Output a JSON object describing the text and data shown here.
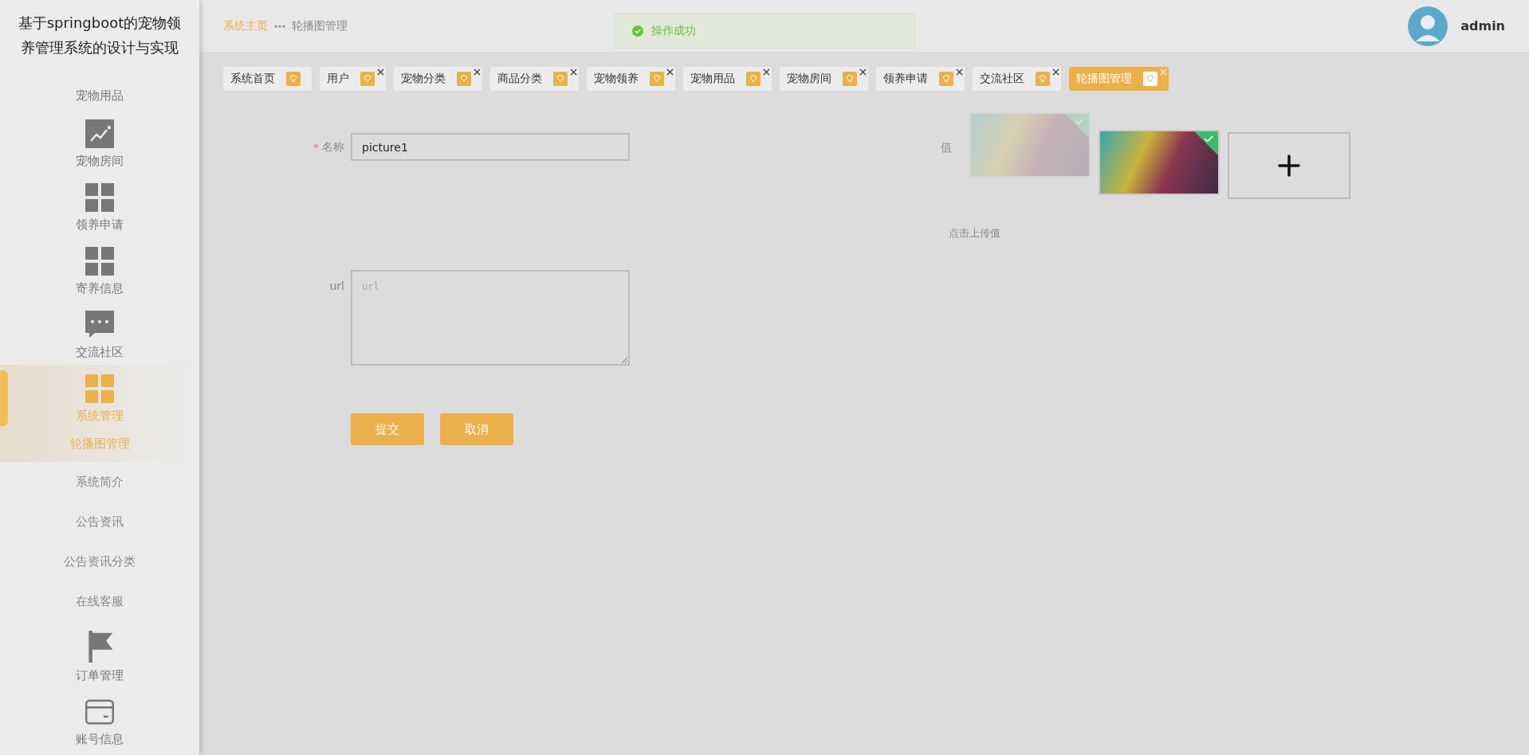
{
  "sidebar": {
    "title": "基于springboot的宠物领养管理系统的设计与实现",
    "items": [
      {
        "label": "宠物用品",
        "kind": "label",
        "expanded": false
      },
      {
        "label": "宠物房间",
        "kind": "chart",
        "expanded": false
      },
      {
        "label": "领养申请",
        "kind": "grid",
        "expanded": false
      },
      {
        "label": "寄养信息",
        "kind": "grid",
        "expanded": false
      },
      {
        "label": "交流社区",
        "kind": "chat",
        "expanded": false
      },
      {
        "label": "系统管理",
        "kind": "grid",
        "expanded": true,
        "children": [
          {
            "label": "轮播图管理",
            "selected": true
          },
          {
            "label": "系统简介",
            "selected": false
          },
          {
            "label": "公告资讯",
            "selected": false
          },
          {
            "label": "公告资讯分类",
            "selected": false
          },
          {
            "label": "在线客服",
            "selected": false
          }
        ]
      },
      {
        "label": "订单管理",
        "kind": "flag",
        "expanded": false
      },
      {
        "label": "账号信息",
        "kind": "card",
        "expanded": false
      }
    ]
  },
  "breadcrumb": [
    {
      "label": "系统主页",
      "current": false
    },
    {
      "label": "轮播图管理",
      "current": true
    }
  ],
  "toast": {
    "message": "操作成功",
    "kind": "success"
  },
  "user": {
    "name": "admin"
  },
  "tabs": [
    {
      "label": "系统首页",
      "closable": false,
      "selected": false
    },
    {
      "label": "用户",
      "closable": true,
      "selected": false
    },
    {
      "label": "宠物分类",
      "closable": true,
      "selected": false
    },
    {
      "label": "商品分类",
      "closable": true,
      "selected": false
    },
    {
      "label": "宠物领养",
      "closable": true,
      "selected": false
    },
    {
      "label": "宠物用品",
      "closable": true,
      "selected": false
    },
    {
      "label": "宠物房间",
      "closable": true,
      "selected": false
    },
    {
      "label": "领养申请",
      "closable": true,
      "selected": false
    },
    {
      "label": "交流社区",
      "closable": true,
      "selected": false
    },
    {
      "label": "轮播图管理",
      "closable": true,
      "selected": true
    }
  ],
  "form": {
    "name": {
      "label": "名称",
      "required_mark": "*",
      "value": "picture1"
    },
    "url": {
      "label": "url",
      "placeholder": "url"
    },
    "value": {
      "label": "值",
      "hint": "点击上传值",
      "images": [
        {
          "uploaded": true,
          "fading": true
        },
        {
          "uploaded": true,
          "fading": false
        }
      ]
    },
    "buttons": [
      "提交",
      "取消"
    ]
  }
}
